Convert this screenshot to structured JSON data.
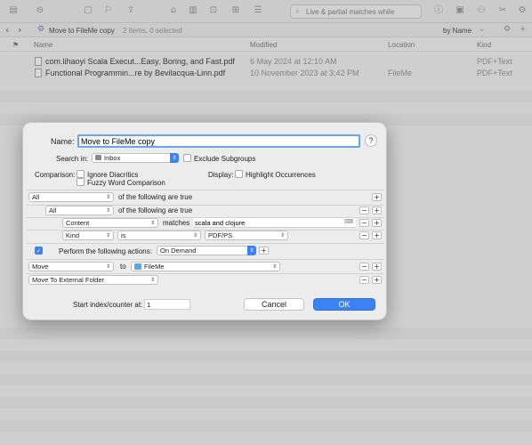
{
  "toolbar": {
    "search_placeholder": "Live & partial matches while"
  },
  "pathbar": {
    "title": "Move to FileMe copy",
    "count": "2 items, 0 selected",
    "sort": "by Name"
  },
  "list": {
    "columns": {
      "name": "Name",
      "modified": "Modified",
      "location": "Location",
      "kind": "Kind"
    },
    "rows": [
      {
        "name": "com.lihaoyi Scala Execut...Easy, Boring, and Fast.pdf",
        "modified": "6 May 2024 at 12:10 AM",
        "location": "",
        "kind": "PDF+Text"
      },
      {
        "name": "Functional Programmin...re by Bevilacqua-Linn.pdf",
        "modified": "10 November 2023 at 3:42 PM",
        "location": "FileMe",
        "kind": "PDF+Text"
      }
    ]
  },
  "dialog": {
    "name_label": "Name:",
    "name_value": "Move to FileMe copy",
    "help": "?",
    "search_in_label": "Search in:",
    "search_in_value": "Inbox",
    "exclude_subgroups": "Exclude Subgroups",
    "comparison_label": "Comparison:",
    "ignore_diacritics": "Ignore Diacritics",
    "fuzzy_word": "Fuzzy Word Comparison",
    "display_label": "Display:",
    "highlight_occurrences": "Highlight Occurrences",
    "rule1": {
      "quantifier": "All",
      "text": "of the following are true"
    },
    "rule2": {
      "quantifier": "All",
      "text": "of the following are true"
    },
    "rule3": {
      "field": "Content",
      "operator": "matches",
      "value": "scala and clojure"
    },
    "rule4": {
      "field": "Kind",
      "operator": "is",
      "value": "PDF/PS"
    },
    "perform_label": "Perform the following actions:",
    "perform_value": "On Demand",
    "action1": {
      "action": "Move",
      "to": "to",
      "target": "FileMe"
    },
    "action2": {
      "action": "Move To External Folder"
    },
    "start_index_label": "Start index/counter at:",
    "start_index_value": "1",
    "cancel": "Cancel",
    "ok": "OK",
    "plus": "+",
    "minus": "−"
  }
}
